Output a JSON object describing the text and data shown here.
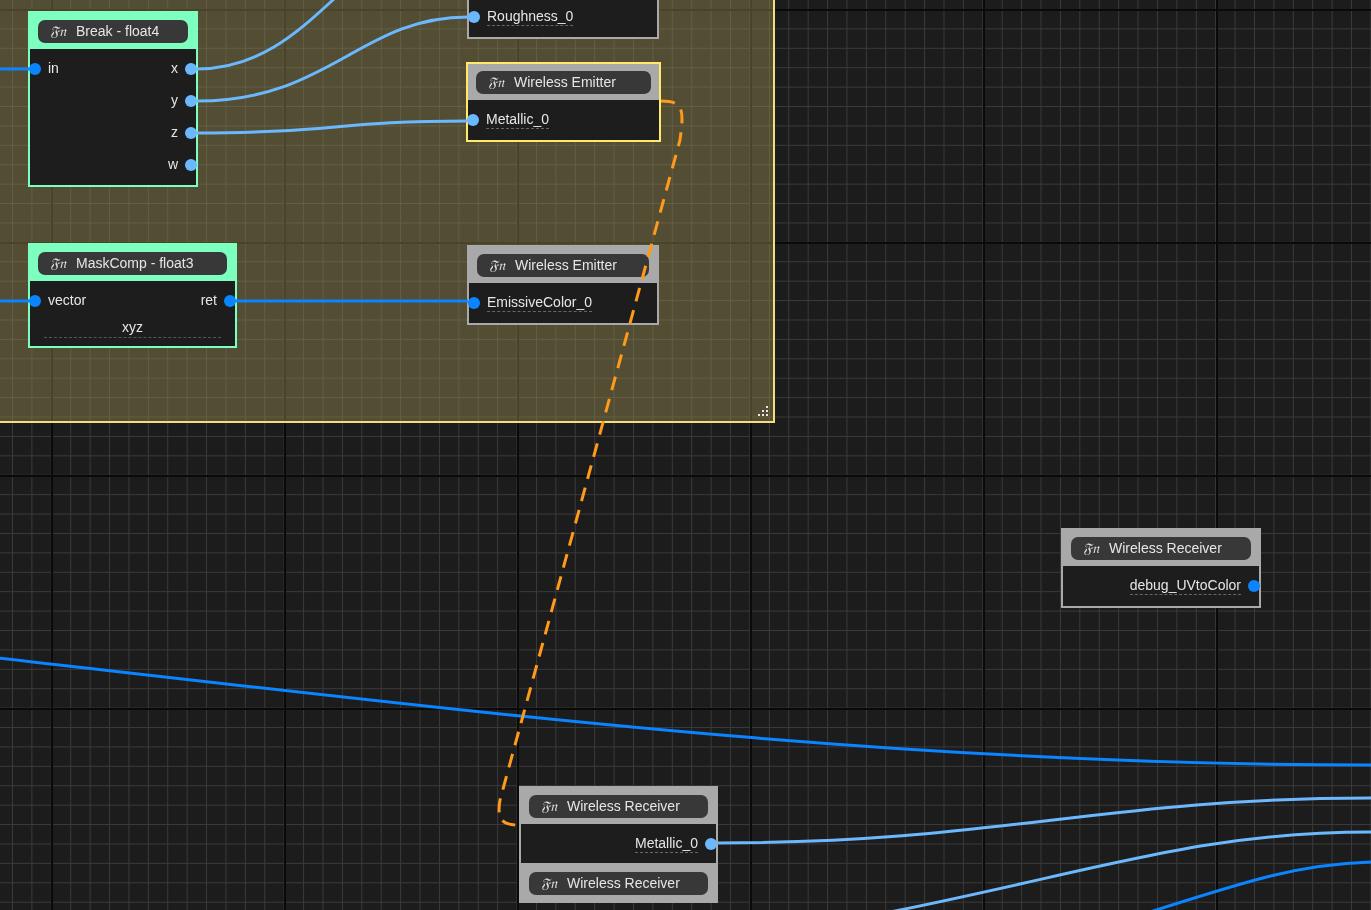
{
  "group": {
    "selected": true
  },
  "nodes": [
    {
      "selected": false,
      "color": "#a9a9a9",
      "rows": [
        {
          "input": {
            "label": "Roughness_0",
            "color": "#6cb8ff",
            "underline": true
          }
        }
      ]
    },
    {
      "icon_text": "𝔉𝔫",
      "title": "Break - float4",
      "selected": false,
      "color": "#7dffc0",
      "rows": [
        {
          "input": {
            "label": "in",
            "color": "#0a84ff",
            "underline": false
          },
          "output": {
            "label": "x",
            "color": "#6cb8ff",
            "underline": false
          }
        },
        {
          "output": {
            "label": "y",
            "color": "#6cb8ff",
            "underline": false
          }
        },
        {
          "output": {
            "label": "z",
            "color": "#6cb8ff",
            "underline": false
          }
        },
        {
          "output": {
            "label": "w",
            "color": "#6cb8ff",
            "underline": false
          }
        }
      ]
    },
    {
      "icon_text": "𝔉𝔫",
      "title": "Wireless Emitter",
      "selected": true,
      "color": "#a9a9a9",
      "rows": [
        {
          "input": {
            "label": "Metallic_0",
            "color": "#6cb8ff",
            "underline": true
          }
        }
      ]
    },
    {
      "icon_text": "𝔉𝔫",
      "title": "MaskComp - float3",
      "selected": false,
      "color": "#7dffc0",
      "rows": [
        {
          "input": {
            "label": "vector",
            "color": "#0a84ff",
            "underline": false
          },
          "output": {
            "label": "ret",
            "color": "#0a84ff",
            "underline": false
          }
        }
      ],
      "footer": "xyz"
    },
    {
      "icon_text": "𝔉𝔫",
      "title": "Wireless Emitter",
      "selected": false,
      "color": "#a9a9a9",
      "rows": [
        {
          "input": {
            "label": "EmissiveColor_0",
            "color": "#0a84ff",
            "underline": true
          }
        }
      ]
    },
    {
      "icon_text": "𝔉𝔫",
      "title": "Wireless Receiver",
      "selected": false,
      "color": "#a9a9a9",
      "rows": [
        {
          "output": {
            "label": "debug_UVtoColor",
            "color": "#0a84ff",
            "underline": true
          }
        }
      ]
    },
    {
      "icon_text": "𝔉𝔫",
      "title": "Wireless Receiver",
      "selected": false,
      "color": "#a9a9a9",
      "rows": [
        {
          "output": {
            "label": "Metallic_0",
            "color": "#6cb8ff",
            "underline": true
          }
        }
      ]
    },
    {
      "icon_text": "𝔉𝔫",
      "title": "Wireless Receiver",
      "selected": false,
      "color": "#a9a9a9"
    }
  ]
}
